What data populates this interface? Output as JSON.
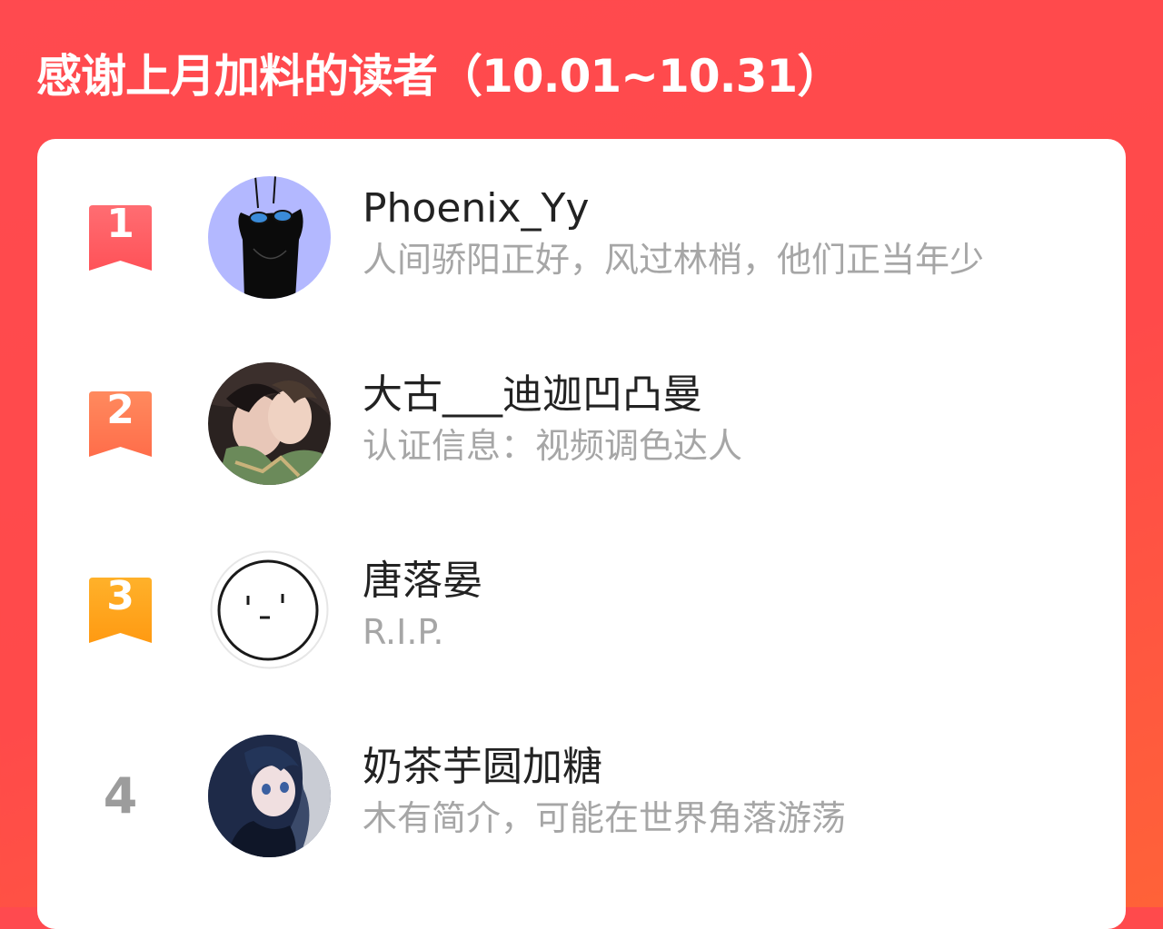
{
  "header": {
    "title": "感谢上月加料的读者（10.01~10.31）"
  },
  "colors": {
    "background": "#ff4a4a",
    "rank1": "#ff5d63",
    "rank2": "#ff7a52",
    "rank3": "#ffa21a",
    "rank_plain": "#9c9c9c",
    "name": "#222222",
    "description": "#a6a6a6"
  },
  "readers": [
    {
      "rank": "1",
      "name": "Phoenix_Yy",
      "description": "人间骄阳正好，风过林梢，他们正当年少",
      "avatar_icon": "black-cat-with-goggles-avatar"
    },
    {
      "rank": "2",
      "name": "大古___迪迦凹凸曼",
      "description": "认证信息：视频调色达人",
      "avatar_icon": "anime-couple-avatar"
    },
    {
      "rank": "3",
      "name": "唐落晏",
      "description": "R.I.P.",
      "avatar_icon": "doodle-face-avatar"
    },
    {
      "rank": "4",
      "name": "奶茶芋圆加糖",
      "description": "木有简介，可能在世界角落游荡",
      "avatar_icon": "anime-girl-blue-hair-avatar"
    }
  ]
}
